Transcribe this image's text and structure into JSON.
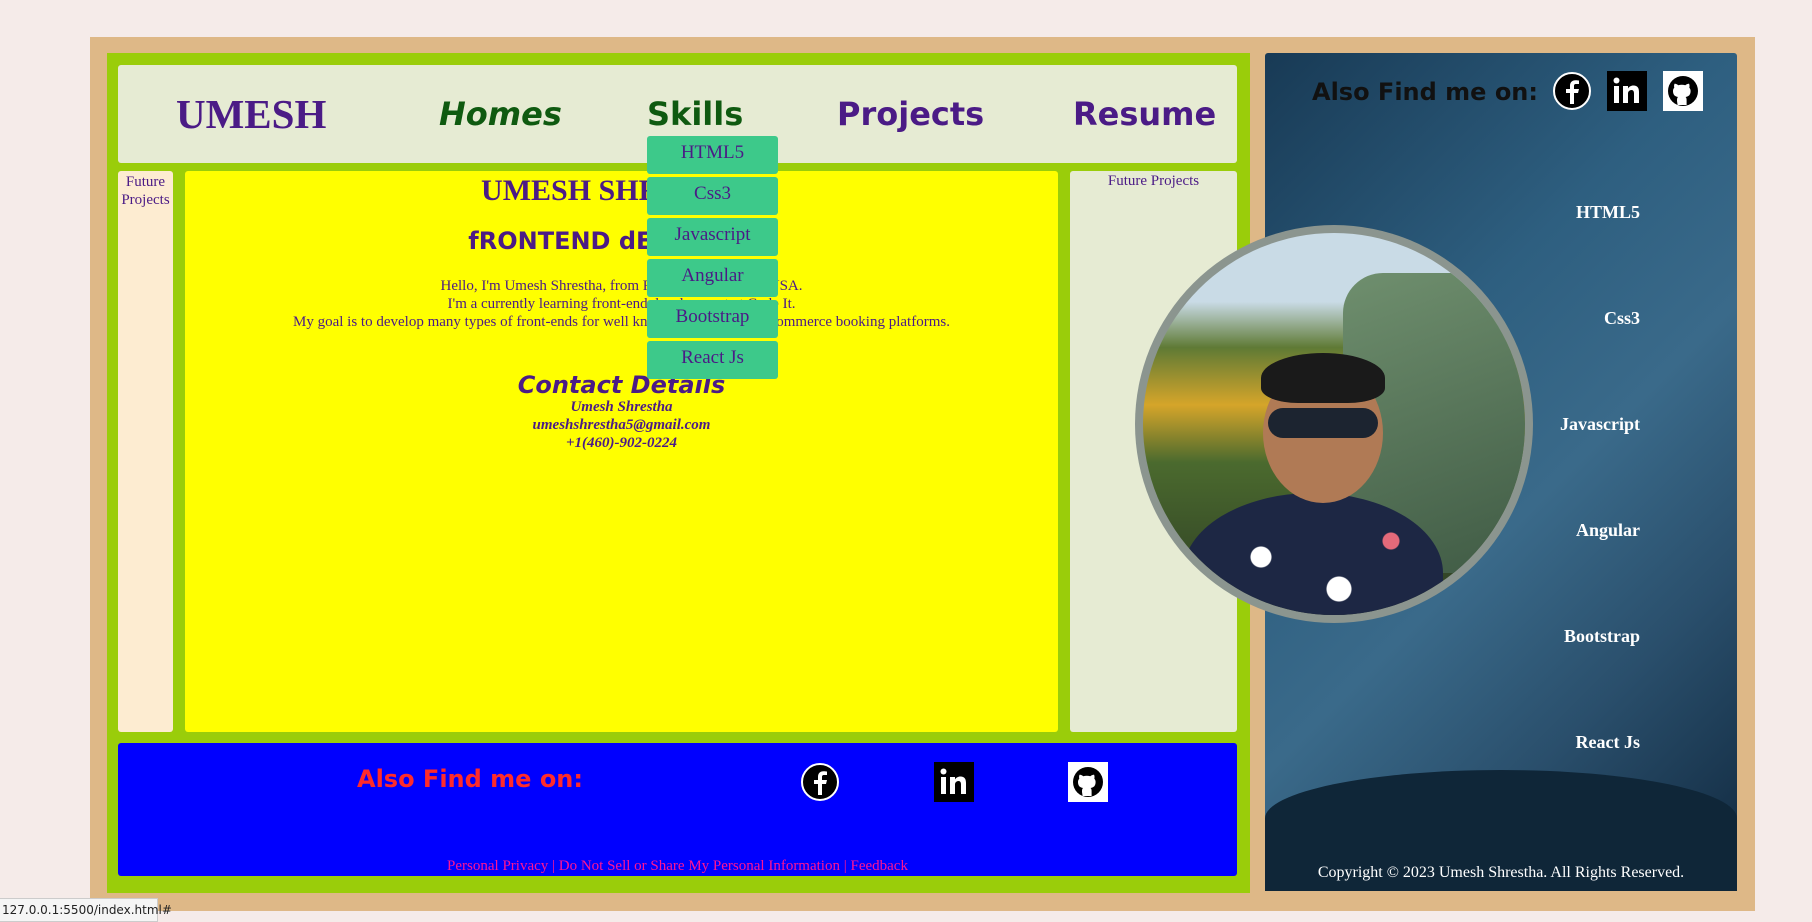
{
  "header": {
    "brand": "UMESH",
    "nav": [
      "Homes",
      "Skills",
      "Projects",
      "Resume"
    ]
  },
  "left_column": {
    "label": "Future Projects"
  },
  "right_column": {
    "label": "Future Projects"
  },
  "main": {
    "title": "UMESH SHRESTHA",
    "subtitle": "fRONTEND dEVELOPER",
    "bio": [
      "Hello, I'm Umesh Shrestha, from Fort Wayne, Indiana USA.",
      "I'm a currently learning front-end development at Code It.",
      "My goal is to develop many types of front-ends for well known companies to Ecommerce booking platforms."
    ],
    "contact_title": "Contact Details",
    "contact": {
      "name": "Umesh Shrestha",
      "email": "umeshshrestha5@gmail.com",
      "phone": "+1(460)-902-0224"
    }
  },
  "skills_dropdown": [
    "HTML5",
    "Css3",
    "Javascript",
    "Angular",
    "Bootstrap",
    "React Js"
  ],
  "footer": {
    "title": "Also Find me on:",
    "links": "Personal Privacy | Do Not Sell or Share My Personal Information | Feedback"
  },
  "sidebar": {
    "title": "Also Find me on:",
    "skills": [
      "HTML5",
      "Css3",
      "Javascript",
      "Angular",
      "Bootstrap",
      "React Js"
    ],
    "copyright": "Copyright © 2023 Umesh Shrestha. All Rights Reserved."
  },
  "social_icons": [
    "facebook-icon",
    "linkedin-icon",
    "github-icon"
  ],
  "status_url": "127.0.0.1:5500/index.html#"
}
